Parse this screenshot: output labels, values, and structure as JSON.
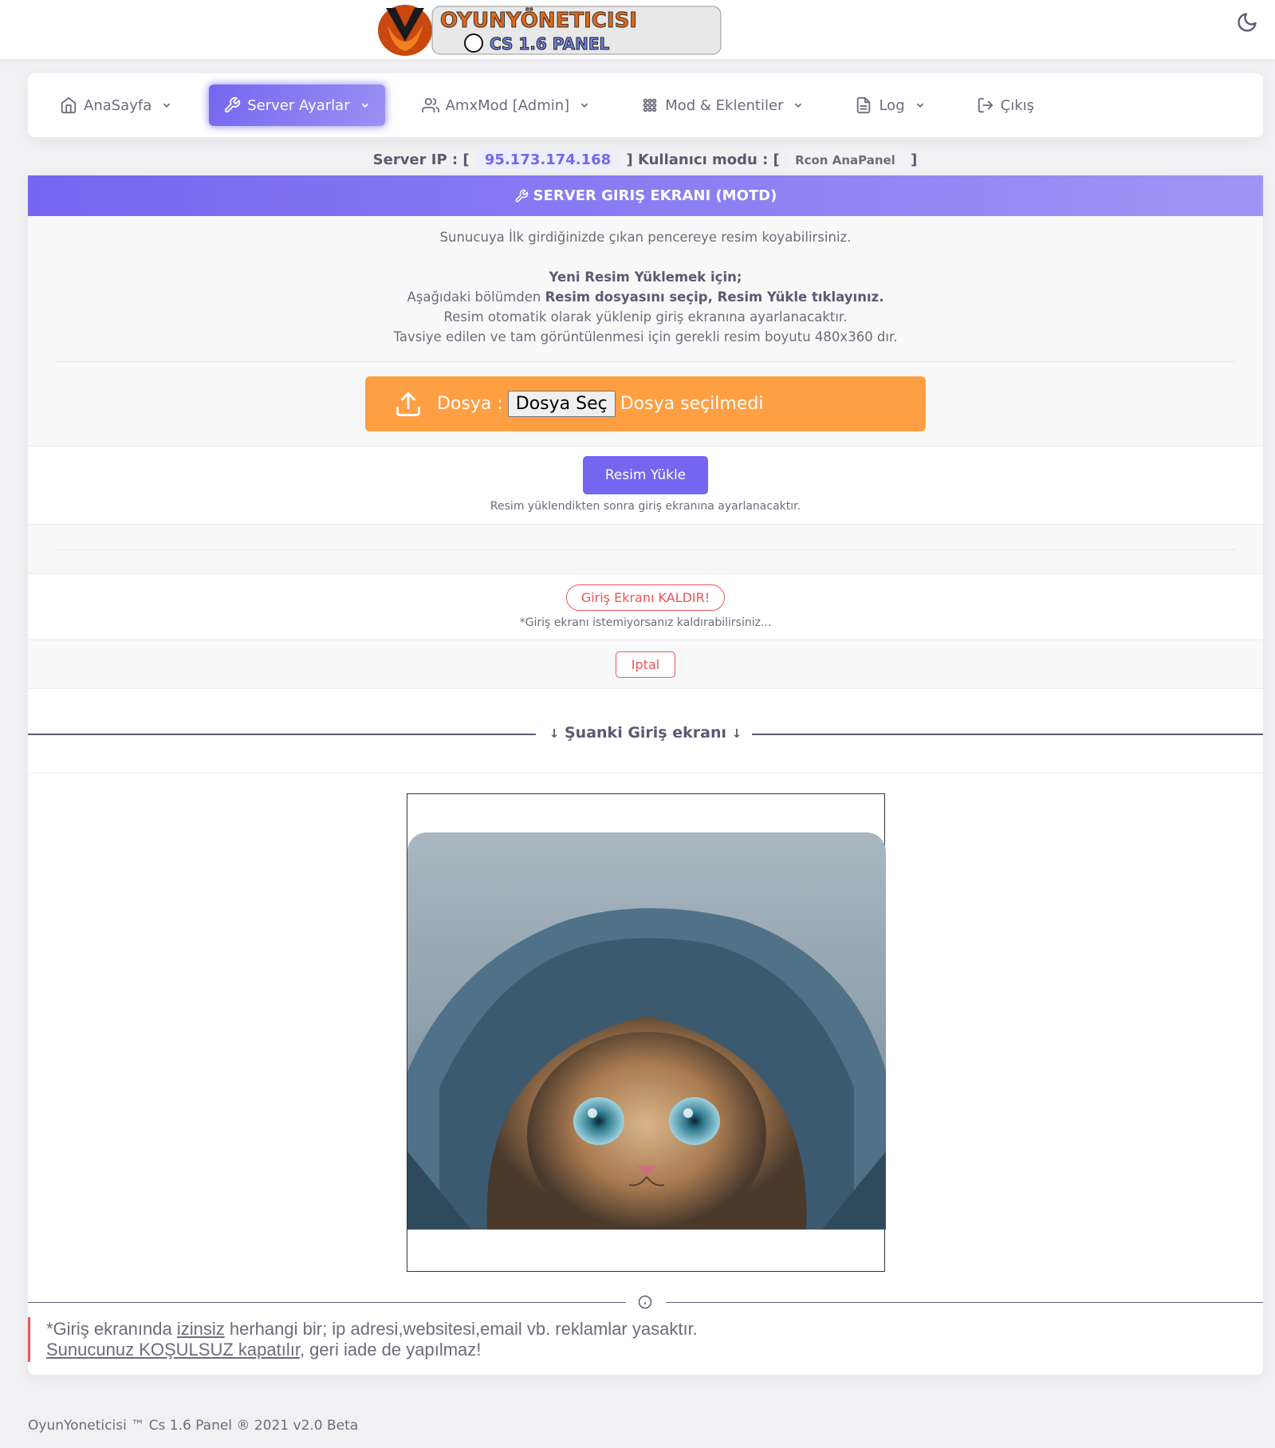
{
  "header": {
    "logo_text_line1": "OYUNYÖNETICISI",
    "logo_text_line2": "CS 1.6 PANEL",
    "theme_toggle_icon": "moon-icon"
  },
  "nav": {
    "items": [
      {
        "label": "AnaSayfa",
        "icon": "home-icon",
        "has_dropdown": true
      },
      {
        "label": "Server Ayarlar",
        "icon": "tool-icon",
        "has_dropdown": true,
        "active": true
      },
      {
        "label": "AmxMod [Admin]",
        "icon": "users-icon",
        "has_dropdown": true
      },
      {
        "label": "Mod & Eklentiler",
        "icon": "grid-icon",
        "has_dropdown": true
      },
      {
        "label": "Log",
        "icon": "file-text-icon",
        "has_dropdown": true
      },
      {
        "label": "Çıkış",
        "icon": "logout-icon",
        "has_dropdown": false
      }
    ]
  },
  "server": {
    "ip_label": "Server IP : [",
    "ip": "95.173.174.168",
    "mode_label": "] Kullanıcı modu : [",
    "mode": "Rcon AnaPanel",
    "close": "]"
  },
  "card": {
    "title": "SERVER GIRIŞ EKRANI (MOTD)",
    "intro": "Sunucuya İlk girdiğinizde çıkan pencereye resim koyabilirsiniz.",
    "howto_title": "Yeni Resim Yüklemek için;",
    "howto_line1_pre": "Aşağıdaki bölümden ",
    "howto_line1_bold": "Resim dosyasını seçip, Resim Yükle tıklayınız.",
    "howto_line2": "Resim otomatik olarak yüklenip giriş ekranına ayarlanacaktır.",
    "howto_line3": "Tavsiye edilen ve tam görüntülenmesi için gerekli resim boyutu 480x360 dır."
  },
  "upload": {
    "label": "Dosya :",
    "choose_button": "Dosya Seç",
    "no_file": "Dosya seçilmedi",
    "submit": "Resim Yükle",
    "submit_hint": "Resim yüklendikten sonra giriş ekranına ayarlanacaktır."
  },
  "remove": {
    "button": "Giriş Ekranı KALDIR!",
    "hint": "*Giriş ekranı istemiyorsanız kaldırabilirsiniz..."
  },
  "cancel": {
    "button": "Iptal"
  },
  "current": {
    "title": "Şuanki Giriş ekranı"
  },
  "warning": {
    "pre": "*Giriş ekranında ",
    "u1": "izinsiz",
    "mid": " herhangi bir; ip adresi,websitesi,email vb. reklamlar yasaktır.",
    "u2": "Sunucunuz KOŞULSUZ kapatılır",
    "post": ", geri iade de yapılmaz!"
  },
  "footer": {
    "text": "OyunYoneticisi ™ Cs 1.6 Panel ® 2021 v2.0 Beta"
  },
  "colors": {
    "primary": "#7367f0",
    "warning": "#ff9f43",
    "danger": "#ea5455"
  }
}
